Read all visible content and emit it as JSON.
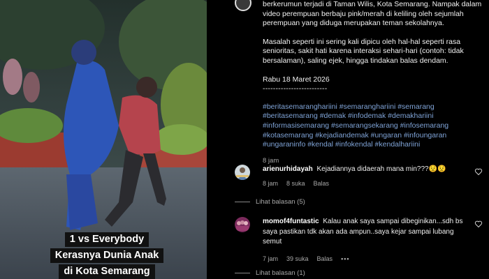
{
  "video": {
    "caption_lines": [
      "1 vs Everybody",
      "Kerasnya Dunia Anak",
      "di Kota Semarang"
    ]
  },
  "post": {
    "para1": "berkerumun terjadi di Taman Wilis, Kota Semarang. Nampak dalam video perempuan berbaju pink/merah di keliling oleh sejumlah perempuan yang diduga merupakan teman sekolahnya.",
    "para2": "Masalah seperti ini sering kali dipicu oleh hal-hal seperti rasa senioritas, sakit hati karena interaksi sehari-hari (contoh: tidak bersalaman), saling ejek, hingga tindakan balas dendam.",
    "date": "Rabu 18 Maret 2026",
    "divider": "-------------------------",
    "hashtags": "#beritasemaranghariini #semaranghariini #semarang #beritasemarang #demak #infodemak #demakhariini #informasisemarang #semarangsekarang #infosemarang #kotasemarang #kejadiandemak #ungaran #infoungaran #ungaraninfo #kendal #infokendal #kendalhariini",
    "time": "8 jam"
  },
  "comments": [
    {
      "username": "arienurhidayah",
      "text": "Kejadiannya didaerah mana min???😟😟",
      "time": "8 jam",
      "likes": "8 suka",
      "reply": "Balas",
      "view_replies": "Lihat balasan (5)"
    },
    {
      "username": "momof4funtastic",
      "text": "Kalau anak saya sampai dibeginikan...sdh bs saya pastikan tdk akan ada ampun..saya kejar sampai lubang semut",
      "time": "7 jam",
      "likes": "39 suka",
      "reply": "Balas",
      "more": "•••",
      "view_replies": "Lihat balasan (1)"
    }
  ],
  "colors": {
    "hashtag": "#7fa3d6",
    "muted": "#a8a8a8",
    "background": "#000000"
  }
}
